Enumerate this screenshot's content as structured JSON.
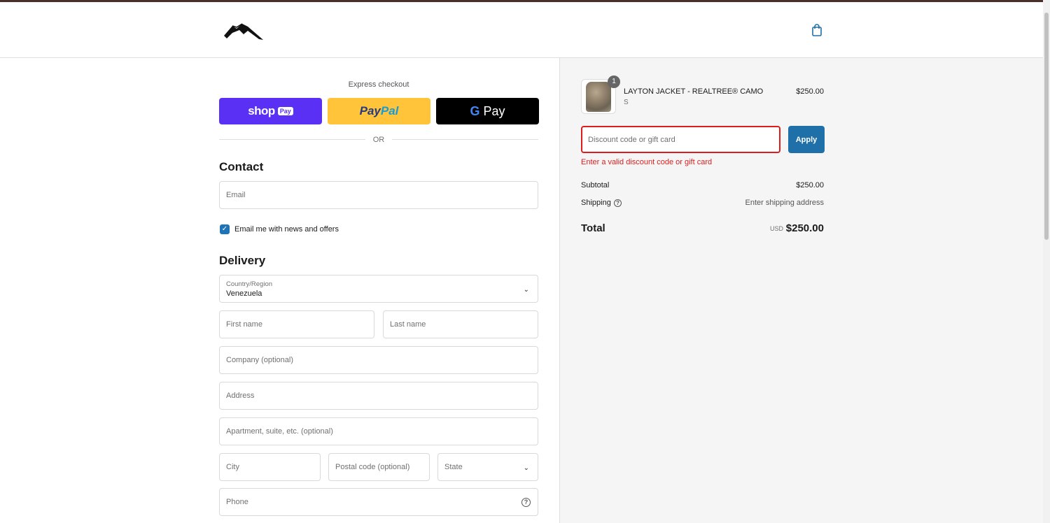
{
  "header": {
    "logo_icon": "mountain-logo",
    "cart_icon": "shopping-bag-icon"
  },
  "express": {
    "label": "Express checkout",
    "shop_pay": {
      "text": "shop",
      "badge": "Pay"
    },
    "paypal": {
      "part1": "Pay",
      "part2": "Pal"
    },
    "gpay": {
      "g": "G",
      "text": "Pay"
    },
    "or": "OR"
  },
  "contact": {
    "title": "Contact",
    "email_placeholder": "Email",
    "newsletter_label": "Email me with news and offers",
    "newsletter_checked": true
  },
  "delivery": {
    "title": "Delivery",
    "country_label": "Country/Region",
    "country_value": "Venezuela",
    "first_name": "First name",
    "last_name": "Last name",
    "company": "Company (optional)",
    "address": "Address",
    "apartment": "Apartment, suite, etc. (optional)",
    "city": "City",
    "postal": "Postal code (optional)",
    "state": "State",
    "phone": "Phone"
  },
  "summary": {
    "product": {
      "quantity": "1",
      "name": "LAYTON JACKET - REALTREE® CAMO",
      "variant": "S",
      "price": "$250.00"
    },
    "discount_placeholder": "Discount code or gift card",
    "apply_label": "Apply",
    "error": "Enter a valid discount code or gift card",
    "subtotal_label": "Subtotal",
    "subtotal_value": "$250.00",
    "shipping_label": "Shipping",
    "shipping_value": "Enter shipping address",
    "total_label": "Total",
    "total_currency": "USD",
    "total_value": "$250.00"
  },
  "colors": {
    "accent": "#1f74b8",
    "error": "#dd1d1d",
    "shop_pay": "#5a31f4",
    "paypal": "#ffc439"
  }
}
